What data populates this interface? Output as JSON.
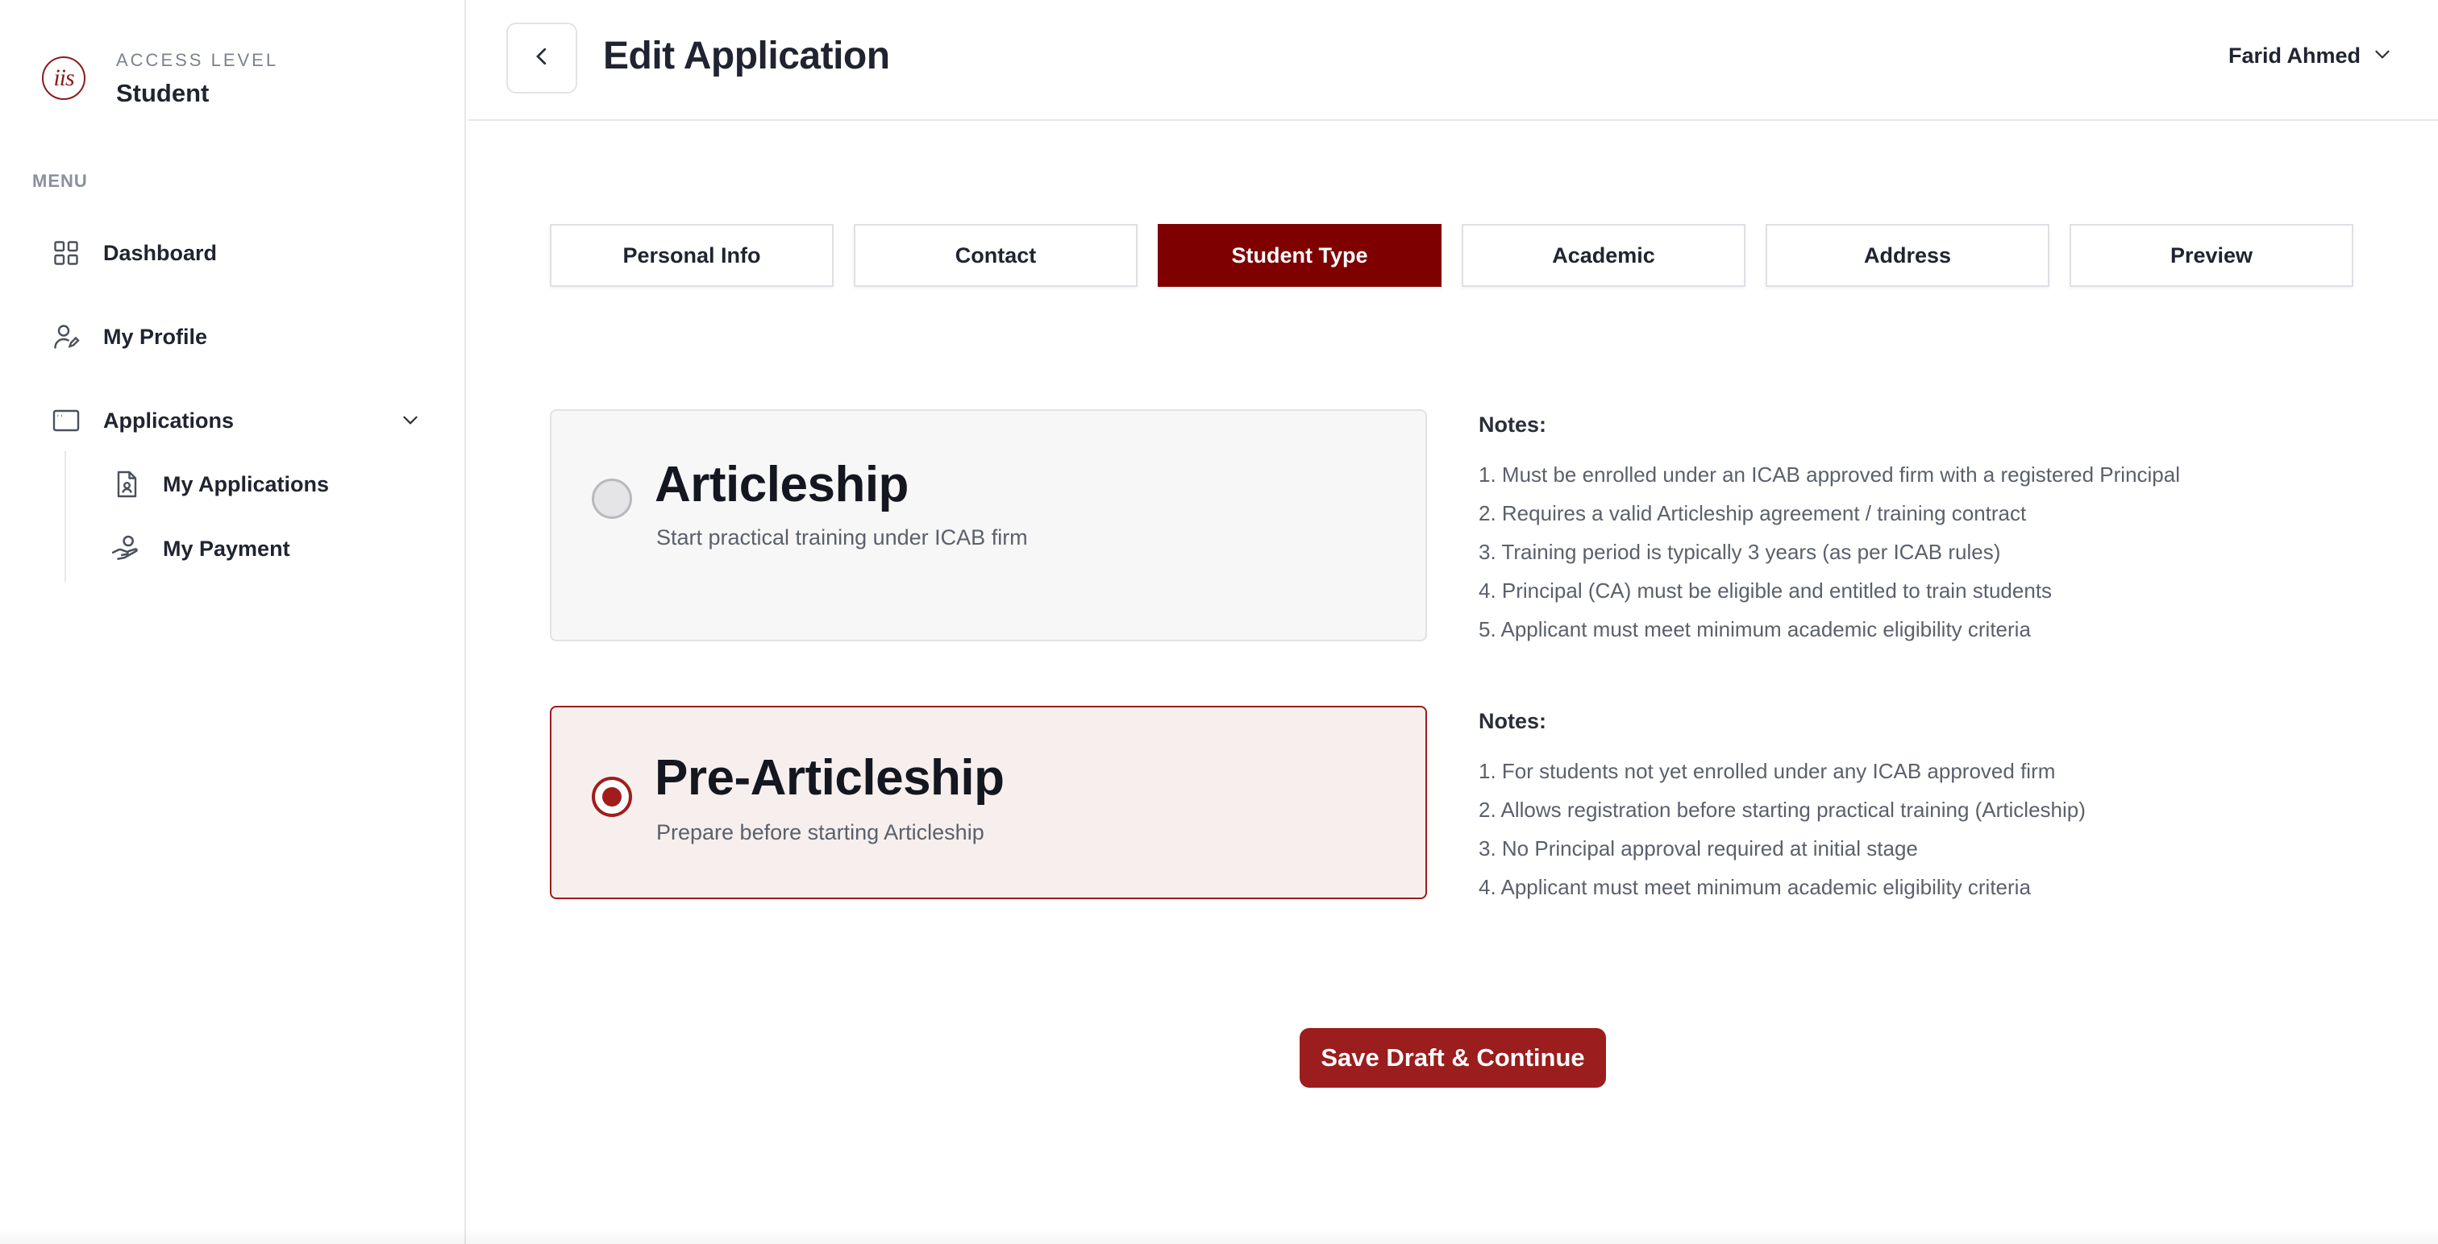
{
  "sidebar": {
    "brand_text": "iis",
    "access_label": "ACCESS LEVEL",
    "access_value": "Student",
    "menu_label": "MENU",
    "items": [
      {
        "label": "Dashboard",
        "icon": "grid-icon"
      },
      {
        "label": "My Profile",
        "icon": "user-edit-icon"
      },
      {
        "label": "Applications",
        "icon": "window-icon",
        "expanded": true
      }
    ],
    "sub_items": [
      {
        "label": "My Applications",
        "icon": "document-user-icon"
      },
      {
        "label": "My Payment",
        "icon": "hand-coin-icon"
      }
    ]
  },
  "header": {
    "title": "Edit Application",
    "user_name": "Farid Ahmed"
  },
  "tabs": [
    {
      "label": "Personal Info",
      "active": false
    },
    {
      "label": "Contact",
      "active": false
    },
    {
      "label": "Student Type",
      "active": true
    },
    {
      "label": "Academic",
      "active": false
    },
    {
      "label": "Address",
      "active": false
    },
    {
      "label": "Preview",
      "active": false
    }
  ],
  "options": [
    {
      "title": "Articleship",
      "description": "Start practical training under ICAB firm",
      "selected": false,
      "notes_heading": "Notes:",
      "notes": [
        "1. Must be enrolled under an ICAB approved firm with a registered Principal",
        "2. Requires a valid Articleship agreement / training contract",
        "3. Training period is typically 3 years (as per ICAB rules)",
        "4. Principal (CA) must be eligible and entitled to train students",
        "5. Applicant must meet minimum academic eligibility criteria"
      ]
    },
    {
      "title": "Pre-Articleship",
      "description": "Prepare before starting Articleship",
      "selected": true,
      "notes_heading": "Notes:",
      "notes": [
        "1. For students not yet enrolled under any ICAB approved firm",
        "2. Allows registration before starting practical training (Articleship)",
        "3. No Principal approval required at initial stage",
        "4. Applicant must meet minimum academic eligibility criteria"
      ]
    }
  ],
  "actions": {
    "save_label": "Save Draft & Continue"
  },
  "colors": {
    "accent": "#7f0000",
    "button": "#9c1d1d",
    "selected_card_bg": "#f6efee"
  }
}
